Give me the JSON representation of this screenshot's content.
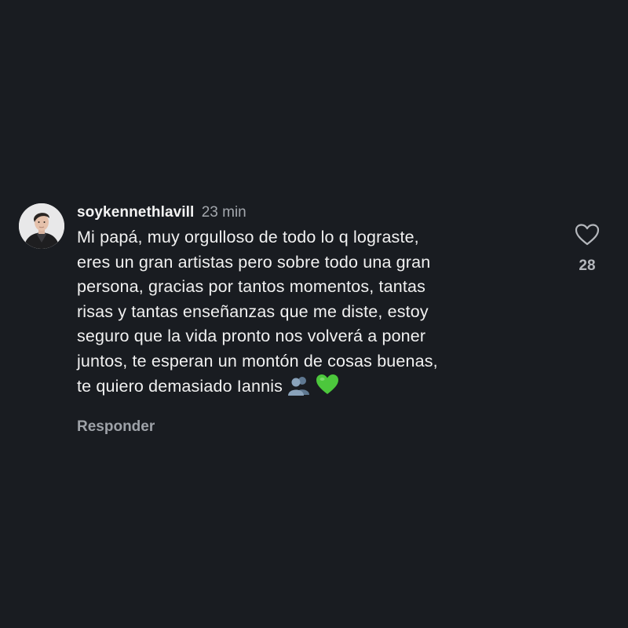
{
  "comment": {
    "username": "soykennethlavill",
    "time": "23 min",
    "text": "Mi papá, muy orgulloso de todo lo q lograste,\neres un gran artistas pero sobre todo una gran\npersona, gracias por tantos momentos, tantas\nrisas y tantas enseñanzas que me diste, estoy\nseguro que la vida pronto nos volverá a poner\njuntos, te esperan un montón de cosas buenas,\nte quiero demasiado Iannis",
    "emojis": [
      "busts-in-silhouette-emoji",
      "green-heart-emoji"
    ],
    "reply_label": "Responder",
    "likes": "28",
    "like_icon": "heart-outline-icon"
  },
  "colors": {
    "background": "#191c21",
    "text": "#f1f1f1",
    "muted": "#a3a7ad",
    "green_heart": "#4cc73c"
  }
}
